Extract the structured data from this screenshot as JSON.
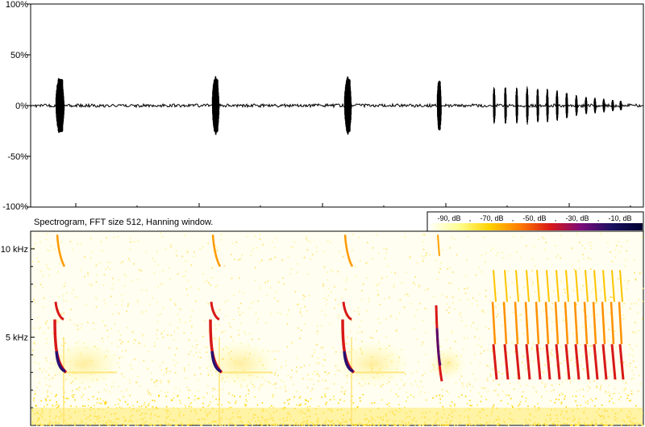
{
  "chart_data": [
    {
      "type": "line",
      "panel": "waveform",
      "y_tick_labels": [
        "100%",
        "50%",
        "0%",
        "-50%",
        "-100%"
      ],
      "ylim": [
        -100,
        100
      ],
      "grid": false,
      "bursts": [
        {
          "center": 75,
          "width": 12,
          "amplitude": 29
        },
        {
          "center": 268,
          "width": 10,
          "amplitude": 29
        },
        {
          "center": 432,
          "width": 10,
          "amplitude": 29
        },
        {
          "center": 545,
          "width": 6,
          "amplitude": 27
        },
        {
          "center": 613,
          "width": 3,
          "amplitude": 19
        },
        {
          "center": 627,
          "width": 3,
          "amplitude": 20
        },
        {
          "center": 641,
          "width": 3,
          "amplitude": 19
        },
        {
          "center": 654,
          "width": 3,
          "amplitude": 19
        },
        {
          "center": 667,
          "width": 3,
          "amplitude": 18
        },
        {
          "center": 679,
          "width": 3,
          "amplitude": 17
        },
        {
          "center": 691,
          "width": 3,
          "amplitude": 16
        },
        {
          "center": 703,
          "width": 3,
          "amplitude": 14
        },
        {
          "center": 715,
          "width": 3,
          "amplitude": 11
        },
        {
          "center": 727,
          "width": 3,
          "amplitude": 9
        },
        {
          "center": 738,
          "width": 3,
          "amplitude": 8
        },
        {
          "center": 749,
          "width": 3,
          "amplitude": 7
        },
        {
          "center": 760,
          "width": 3,
          "amplitude": 6
        },
        {
          "center": 770,
          "width": 3,
          "amplitude": 5
        }
      ]
    },
    {
      "type": "heatmap",
      "panel": "spectrogram",
      "title": "Spectrogram, FFT size 512, Hanning window.",
      "y_tick_labels": [
        "10 kHz",
        "5 kHz"
      ],
      "y_tick_values_khz": [
        10,
        5
      ],
      "ylim_khz": [
        0,
        11
      ],
      "colorbar_labels": [
        "-90, dB",
        "-70, dB",
        "-50, dB",
        "-30, dB",
        "-10, dB"
      ],
      "colorbar_colors": [
        "#ffffff",
        "#ffff90",
        "#ffd200",
        "#ff7a00",
        "#d81818",
        "#7a0a7a",
        "#1a1060",
        "#000030"
      ],
      "calls": [
        {
          "center": 75,
          "kind": "down"
        },
        {
          "center": 268,
          "kind": "down"
        },
        {
          "center": 432,
          "kind": "down"
        },
        {
          "center": 545,
          "kind": "short"
        },
        {
          "center": 613,
          "kind": "trill"
        },
        {
          "center": 627,
          "kind": "trill"
        },
        {
          "center": 641,
          "kind": "trill"
        },
        {
          "center": 654,
          "kind": "trill"
        },
        {
          "center": 667,
          "kind": "trill"
        },
        {
          "center": 679,
          "kind": "trill"
        },
        {
          "center": 691,
          "kind": "trill"
        },
        {
          "center": 703,
          "kind": "trill"
        },
        {
          "center": 715,
          "kind": "trill"
        },
        {
          "center": 727,
          "kind": "trill"
        },
        {
          "center": 738,
          "kind": "trill"
        },
        {
          "center": 749,
          "kind": "trill"
        },
        {
          "center": 760,
          "kind": "trill"
        },
        {
          "center": 770,
          "kind": "trill"
        }
      ]
    }
  ]
}
